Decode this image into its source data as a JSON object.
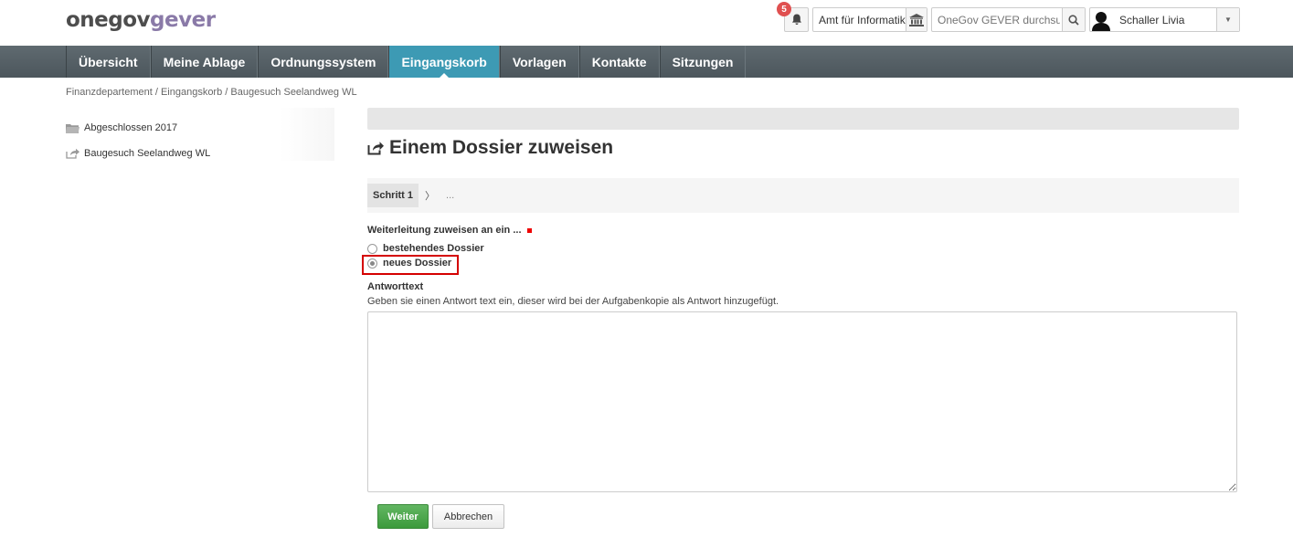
{
  "header": {
    "logo_part1": "onegov",
    "logo_part2": "gever",
    "notification_count": "5",
    "org_label": "Amt für Informatik",
    "search_placeholder": "OneGov GEVER durchsuc",
    "user_name": "Schaller Livia"
  },
  "nav": {
    "items": [
      {
        "label": "Übersicht"
      },
      {
        "label": "Meine Ablage"
      },
      {
        "label": "Ordnungssystem"
      },
      {
        "label": "Eingangskorb"
      },
      {
        "label": "Vorlagen"
      },
      {
        "label": "Kontakte"
      },
      {
        "label": "Sitzungen"
      }
    ],
    "active_index": 3
  },
  "breadcrumb": "Finanzdepartement / Eingangskorb / Baugesuch Seelandweg WL",
  "sidebar": {
    "items": [
      {
        "label": "Abgeschlossen 2017",
        "icon": "folder-icon"
      },
      {
        "label": "Baugesuch Seelandweg WL",
        "icon": "forward-icon"
      }
    ]
  },
  "main": {
    "title": "Einem Dossier zuweisen",
    "wizard": {
      "step1": "Schritt 1",
      "chevron": "〉",
      "more": "..."
    },
    "assign_label": "Weiterleitung zuweisen an ein ...",
    "options": [
      {
        "label": "bestehendes Dossier",
        "selected": false
      },
      {
        "label": "neues Dossier",
        "selected": true
      }
    ],
    "response_label": "Antworttext",
    "response_help": "Geben sie einen Antwort text ein, dieser wird bei der Aufgabenkopie als Antwort hinzugefügt.",
    "response_value": "",
    "submit_label": "Weiter",
    "cancel_label": "Abbrechen"
  },
  "colors": {
    "nav_active": "#3d9ab4",
    "submit_green": "#4cae4c",
    "highlight_red": "#d40000",
    "badge_red": "#e05050"
  }
}
